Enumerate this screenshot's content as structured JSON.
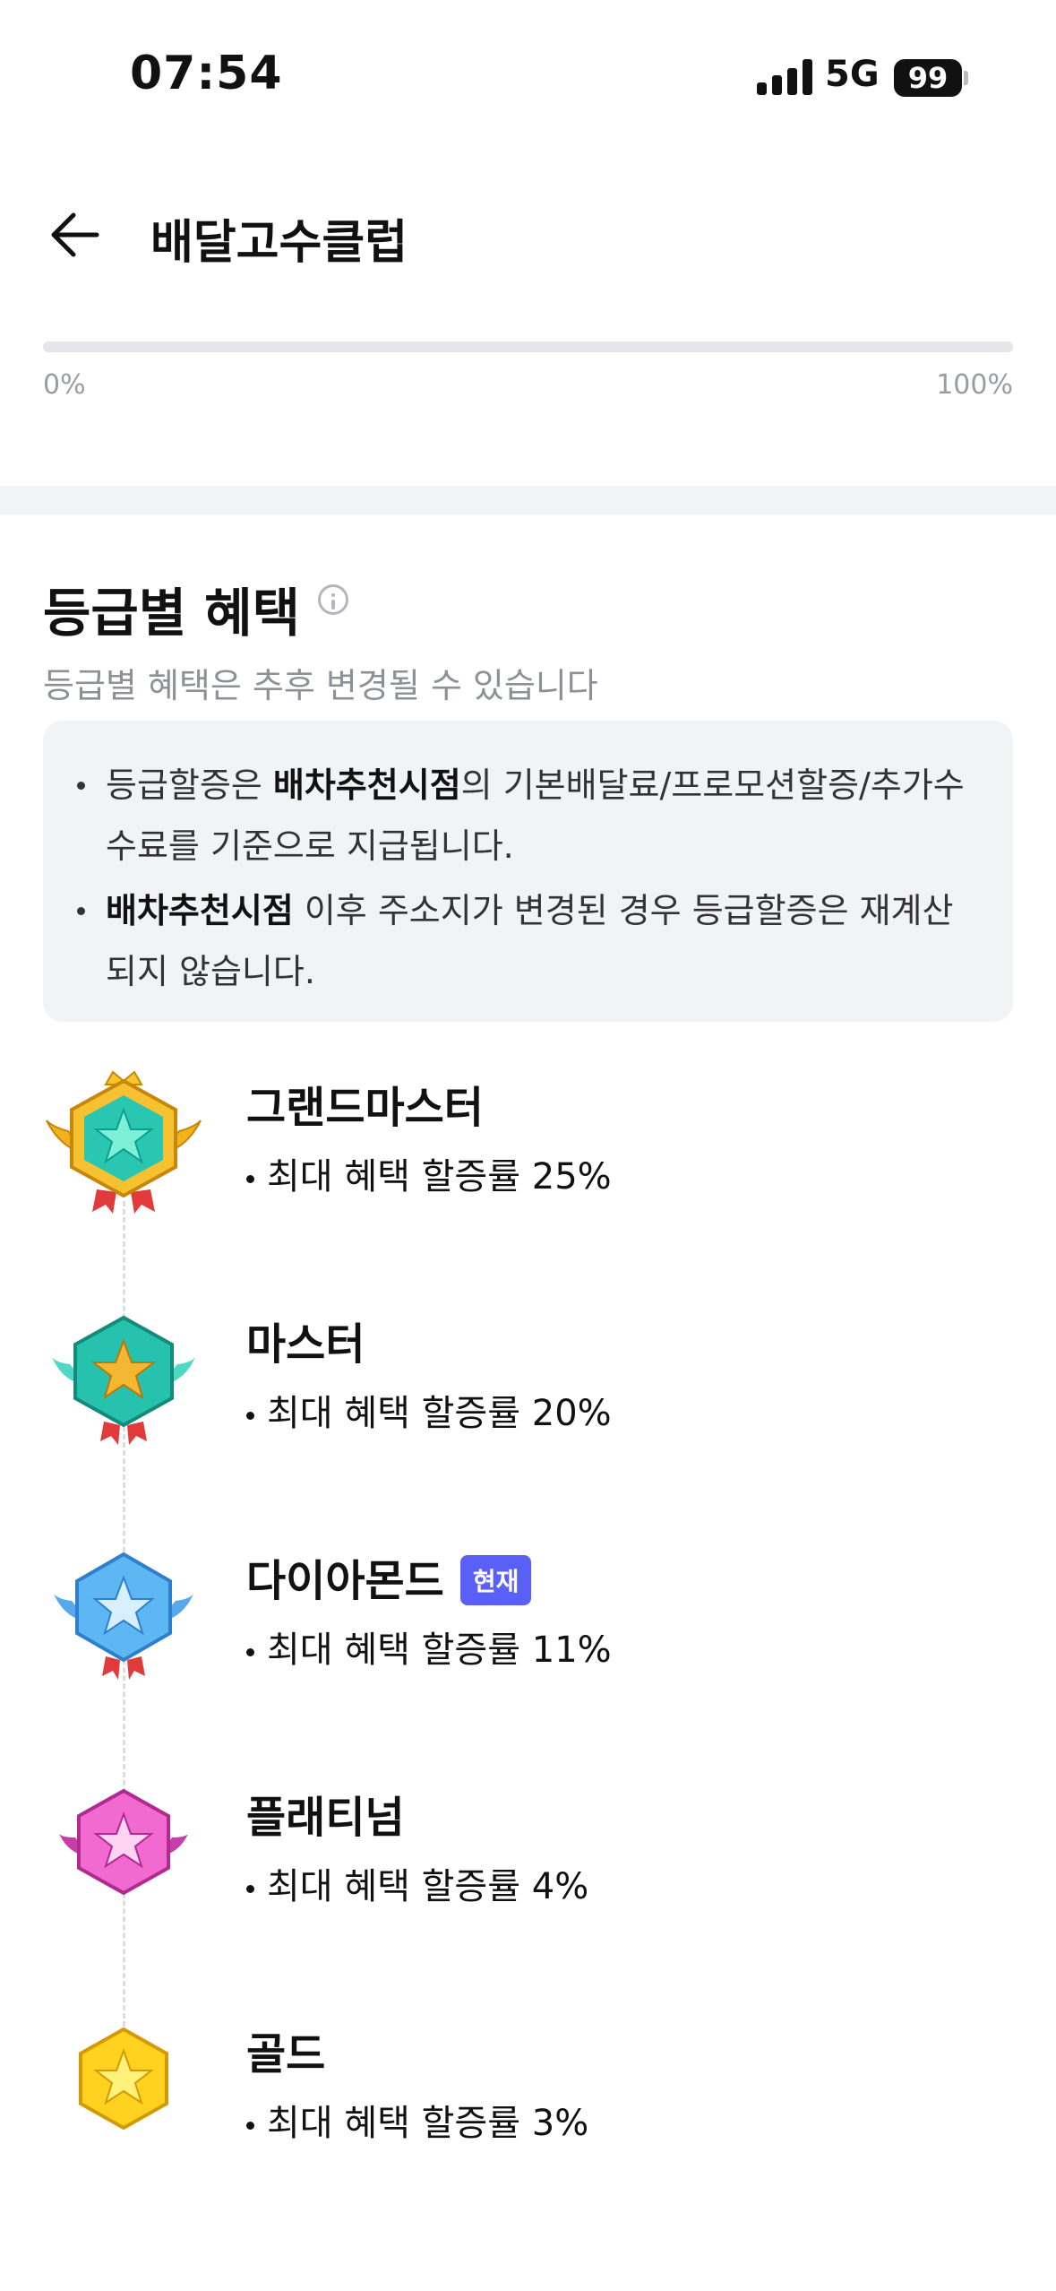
{
  "status_bar": {
    "time": "07:54",
    "network": "5G",
    "battery": "99"
  },
  "header": {
    "title": "배달고수클럽"
  },
  "progress": {
    "value_percent": 0,
    "min_label": "0%",
    "max_label": "100%"
  },
  "section": {
    "title": "등급별 혜택",
    "subtitle": "등급별 혜택은 추후 변경될 수 있습니다",
    "notice": [
      {
        "bold": "배차추천시점",
        "prefix": "등급할증은 ",
        "suffix": "의 기본배달료/프로모션할증/추가수수료를 기준으로 지급됩니다."
      },
      {
        "bold": "배차추천시점",
        "prefix": "",
        "suffix": " 이후 주소지가 변경된 경우 등급할증은 재계산되지 않습니다."
      }
    ]
  },
  "tiers": [
    {
      "name": "그랜드마스터",
      "benefit": "최대 혜택 할증률 25%",
      "icon": "grandmaster-badge-icon"
    },
    {
      "name": "마스터",
      "benefit": "최대 혜택 할증률 20%",
      "icon": "master-badge-icon"
    },
    {
      "name": "다이아몬드",
      "benefit": "최대 혜택 할증률 11%",
      "icon": "diamond-badge-icon",
      "current_label": "현재"
    },
    {
      "name": "플래티넘",
      "benefit": "최대 혜택 할증률 4%",
      "icon": "platinum-badge-icon"
    },
    {
      "name": "골드",
      "benefit": "최대 혜택 할증률 3%",
      "icon": "gold-badge-icon"
    }
  ],
  "colors": {
    "accent": "#5a5ff5",
    "panel": "#f2f3f5",
    "muted": "#8d9096"
  }
}
